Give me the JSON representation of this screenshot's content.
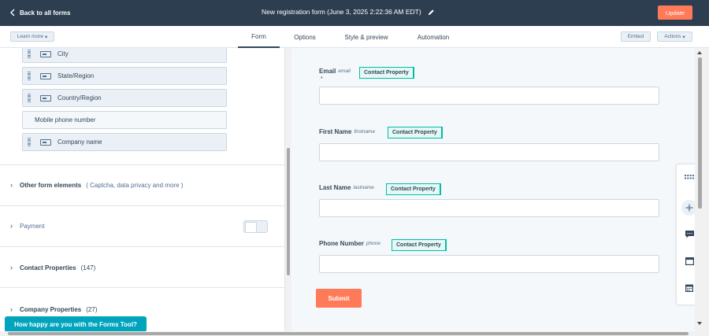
{
  "topbar": {
    "back_label": "Back to all forms",
    "form_title": "New registration form (June 3, 2025 2:22:36 AM EDT)",
    "update_label": "Update"
  },
  "subnav": {
    "learn_more_label": "Learn more",
    "tabs": [
      {
        "label": "Form",
        "active": true
      },
      {
        "label": "Options",
        "active": false
      },
      {
        "label": "Style & preview",
        "active": false
      },
      {
        "label": "Automation",
        "active": false
      }
    ],
    "embed_label": "Embed",
    "actions_label": "Actions"
  },
  "left_panel": {
    "fields": [
      {
        "label": "City",
        "draggable": true
      },
      {
        "label": "State/Region",
        "draggable": true
      },
      {
        "label": "Country/Region",
        "draggable": true
      },
      {
        "label": "Mobile phone number",
        "draggable": false
      },
      {
        "label": "Company name",
        "draggable": true
      }
    ],
    "sections": [
      {
        "title": "Other form elements",
        "detail": "( Captcha, data privacy and more )"
      },
      {
        "title": "Payment",
        "detail": ""
      },
      {
        "title": "Contact Properties",
        "detail": "(147)"
      },
      {
        "title": "Company Properties",
        "detail": "(27)"
      }
    ],
    "feedback_label": "How happy are you with the Forms Tool?"
  },
  "preview": {
    "fields": [
      {
        "label": "Email",
        "internal_name": "email",
        "badge": "Contact Property",
        "required_mark": "*"
      },
      {
        "label": "First Name",
        "internal_name": "firstname",
        "badge": "Contact Property"
      },
      {
        "label": "Last Name",
        "internal_name": "lastname",
        "badge": "Contact Property"
      },
      {
        "label": "Phone Number",
        "internal_name": "phone",
        "badge": "Contact Property"
      }
    ],
    "submit_label": "Submit"
  },
  "right_tools": {
    "icons": [
      "grid-icon",
      "sparkle-icon",
      "chat-icon",
      "window-icon",
      "calendar-icon"
    ]
  },
  "colors": {
    "header_bg": "#2d3e50",
    "accent": "#ff7a59",
    "badge_border": "#00bda5",
    "feedback_bg": "#00a4bd"
  }
}
